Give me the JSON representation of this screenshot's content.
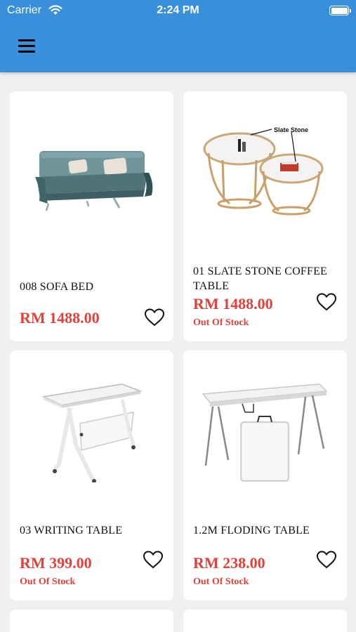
{
  "status_bar": {
    "carrier": "Carrier",
    "time": "2:24 PM"
  },
  "header": {
    "menu_icon": "hamburger-menu-icon"
  },
  "products": [
    {
      "name": "008 SOFA BED",
      "price": "RM 1488.00",
      "stock": "",
      "image": "sofa-bed-image"
    },
    {
      "name": "01 SLATE STONE COFFEE TABLE",
      "price": "RM 1488.00",
      "stock": "Out Of Stock",
      "image": "coffee-table-image",
      "image_label": "Slate Stone"
    },
    {
      "name": "03 WRITING TABLE",
      "price": "RM 399.00",
      "stock": "Out Of Stock",
      "image": "writing-table-image"
    },
    {
      "name": "1.2M FLODING TABLE",
      "price": "RM 238.00",
      "stock": "Out Of Stock",
      "image": "folding-table-image"
    }
  ],
  "colors": {
    "header": "#3a8fdb",
    "price": "#e2403a",
    "background": "#f0f0f2"
  }
}
